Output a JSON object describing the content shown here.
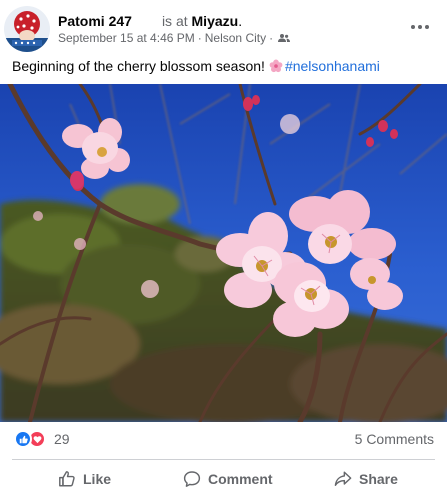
{
  "post": {
    "author": "Patomi 247",
    "checkin_prefix": "is at",
    "place": "Miyazu",
    "place_suffix": ".",
    "date": "September 15 at 4:46 PM",
    "location": "Nelson City",
    "audience_icon": "friends-icon",
    "caption": "Beginning of the cherry blossom season!",
    "caption_emoji": "cherry-blossom-icon",
    "hashtag": "#nelsonhanami"
  },
  "stats": {
    "reaction_count": "29",
    "reactions": [
      "like",
      "love"
    ],
    "comments": "5 Comments"
  },
  "actions": {
    "like": "Like",
    "comment": "Comment",
    "share": "Share"
  },
  "colors": {
    "link": "#216fdb",
    "secondary_text": "#65676b",
    "like_blue": "#1877f2",
    "love_red": "#f33e58"
  }
}
